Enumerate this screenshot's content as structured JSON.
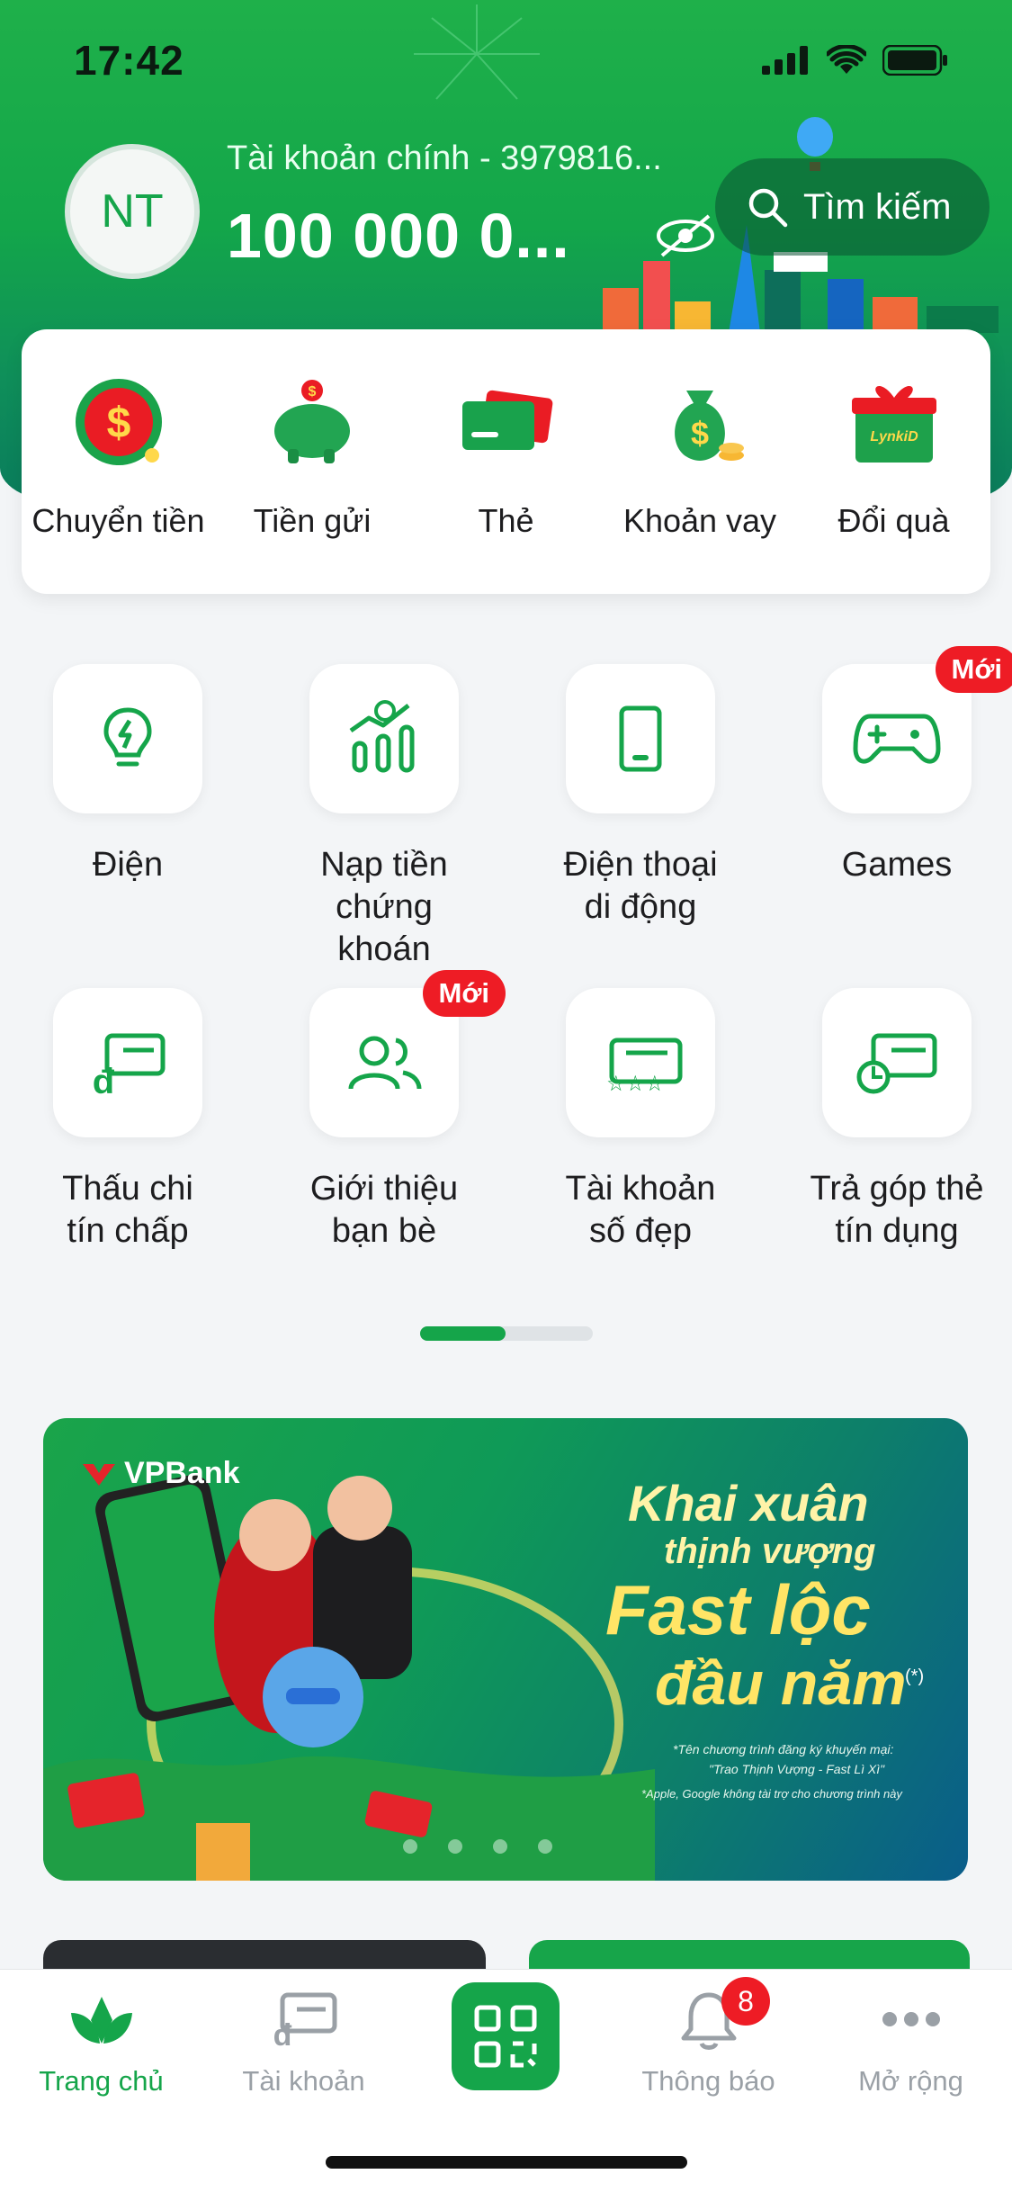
{
  "status_bar": {
    "time": "17:42"
  },
  "header": {
    "avatar_initials": "NT",
    "account_label": "Tài khoản chính - 3979816...",
    "balance": "100 000 0...",
    "search_label": "Tìm kiếm"
  },
  "quick_actions": [
    {
      "label": "Chuyển tiền",
      "icon": "money-transfer-icon"
    },
    {
      "label": "Tiền gửi",
      "icon": "piggy-bank-icon"
    },
    {
      "label": "Thẻ",
      "icon": "cards-icon"
    },
    {
      "label": "Khoản vay",
      "icon": "money-bag-icon"
    },
    {
      "label": "Đổi quà",
      "icon": "gift-box-icon"
    }
  ],
  "badges": {
    "new": "Mới"
  },
  "services": [
    {
      "line1": "Điện",
      "line2": "",
      "icon": "lightbulb-icon"
    },
    {
      "line1": "Nạp tiền",
      "line2": "chứng khoán",
      "icon": "stock-chart-icon"
    },
    {
      "line1": "Điện thoại",
      "line2": "di động",
      "icon": "mobile-phone-icon"
    },
    {
      "line1": "Games",
      "line2": "",
      "icon": "gamepad-icon"
    },
    {
      "line1": "Thấu chi",
      "line2": "tín chấp",
      "icon": "overdraft-card-icon"
    },
    {
      "line1": "Giới thiệu",
      "line2": "bạn bè",
      "icon": "users-icon"
    },
    {
      "line1": "Tài khoản",
      "line2": "số đẹp",
      "icon": "star-account-icon"
    },
    {
      "line1": "Trả góp thẻ",
      "line2": "tín dụng",
      "icon": "installment-card-icon"
    }
  ],
  "pager": {
    "current_page": 1,
    "total_pages": 2
  },
  "banner": {
    "brand": "VPBank",
    "title_line1": "Khai xuân",
    "title_line2": "thịnh vượng",
    "title_line3": "Fast lộc",
    "title_line4": "đầu năm",
    "footnote_mark": "(*)",
    "note1": "*Tên chương trình đăng ký khuyến mại:",
    "note2": "\"Trao Thịnh Vượng - Fast Lì Xì\"",
    "note3": "*Apple, Google không tài trợ cho chương trình này",
    "carousel_current": 1,
    "carousel_total": 4
  },
  "bottom_nav": {
    "home": "Trang chủ",
    "account": "Tài khoản",
    "notifications": "Thông báo",
    "notifications_count": "8",
    "more": "Mở rộng"
  },
  "colors": {
    "brand_green": "#15a54a",
    "badge_red": "#ee1c25",
    "inactive_gray": "#9aa0a6"
  }
}
